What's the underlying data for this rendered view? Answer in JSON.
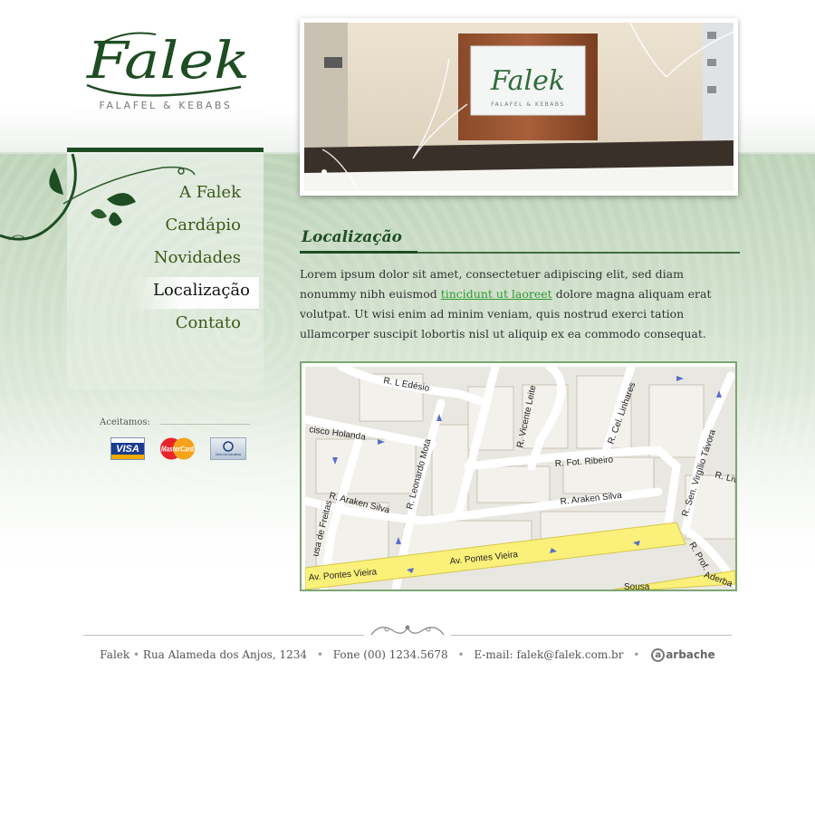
{
  "brand": {
    "name": "Falek",
    "tagline": "FALAFEL & KEBABS",
    "sign_name": "Falek",
    "sign_tagline": "FALAFEL & KEBABS"
  },
  "nav": {
    "items": [
      {
        "label": "A Falek",
        "active": false
      },
      {
        "label": "Cardápio",
        "active": false
      },
      {
        "label": "Novidades",
        "active": false
      },
      {
        "label": "Localização",
        "active": true
      },
      {
        "label": "Contato",
        "active": false
      }
    ]
  },
  "payments": {
    "label": "Aceitamos:",
    "cards": [
      {
        "name": "VISA",
        "icon": "visa-card-icon"
      },
      {
        "name": "MasterCard",
        "icon": "mastercard-icon"
      },
      {
        "name": "Diners Club International",
        "icon": "diners-club-icon"
      }
    ]
  },
  "content": {
    "title": "Localização",
    "paragraph_before_link": "Lorem ipsum dolor sit amet, consectetuer adipiscing elit, sed diam nonummy nibh euismod ",
    "link_text": "tincidunt ut laoreet",
    "paragraph_after_link": " dolore magna aliquam erat volutpat. Ut wisi enim ad minim veniam, quis nostrud exerci tation ullamcorper suscipit lobortis nisl ut aliquip ex ea commodo consequat."
  },
  "map": {
    "streets": {
      "edesio": "R. L Edésio",
      "holanda": "cisco Holanda",
      "leonardo_mota": "R. Leonardo Mota",
      "vicente_leite": "R. Vicente Leite",
      "linhares": "R. Cel. Linhares",
      "fot_ribeiro": "R. Fot. Ribeiro",
      "araken_1": "R. Araken Silva",
      "araken_2": "R. Araken Silva",
      "tavora": "R. Sen. Virgílio Távora",
      "liv": "R. Liv.",
      "freitas": "usa de Freitas",
      "pontes_1": "Av. Pontes Vieira",
      "pontes_2": "Av. Pontes Vieira",
      "prof": "R. Prof.",
      "adherbal": "Aderba",
      "sousa": "Sousa"
    }
  },
  "footer": {
    "company": "Falek",
    "address": "Rua Alameda dos Anjos, 1234",
    "phone": "Fone (00) 1234.5678",
    "email": "E-mail: falek@falek.com.br",
    "credit": "arbache",
    "separator": "•"
  },
  "colors": {
    "brand_green": "#1f4d23",
    "nav_green": "#3b5a1a",
    "link_green": "#2f9a33",
    "map_border": "#7da672",
    "avenue_yellow": "#fbf17a"
  }
}
